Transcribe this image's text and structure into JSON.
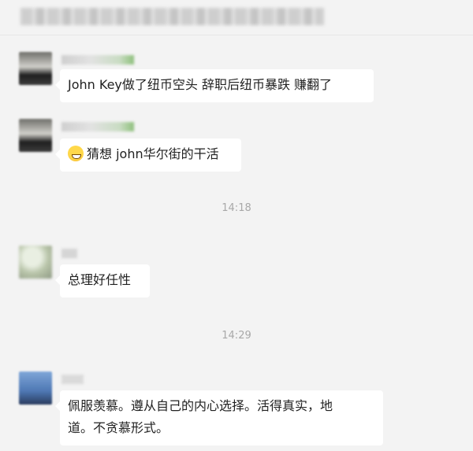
{
  "header": {
    "title": ""
  },
  "timeline": [
    {
      "type": "message",
      "avatar": "avatar-dark",
      "sender": "",
      "text": "John Key做了纽币空头 辞职后纽币暴跌 赚翻了",
      "emoji": ""
    },
    {
      "type": "message",
      "avatar": "avatar-dark",
      "sender": "",
      "text": "猜想 john华尔街的干活",
      "emoji": "grinning-emoji-icon"
    },
    {
      "type": "timestamp",
      "text": "14:18"
    },
    {
      "type": "message",
      "avatar": "avatar-light",
      "sender": "",
      "text": "总理好任性",
      "emoji": ""
    },
    {
      "type": "timestamp",
      "text": "14:29"
    },
    {
      "type": "message",
      "avatar": "avatar-blue",
      "sender": "",
      "text_lines": [
        "佩服羡慕。遵从自己的内心选择。活得真实，地",
        "道。不贪慕形式。"
      ],
      "emoji": ""
    }
  ],
  "colors": {
    "background": "#f3f3f3",
    "bubble": "#ffffff",
    "timestamp": "#a8a8a8",
    "text": "#222222"
  }
}
